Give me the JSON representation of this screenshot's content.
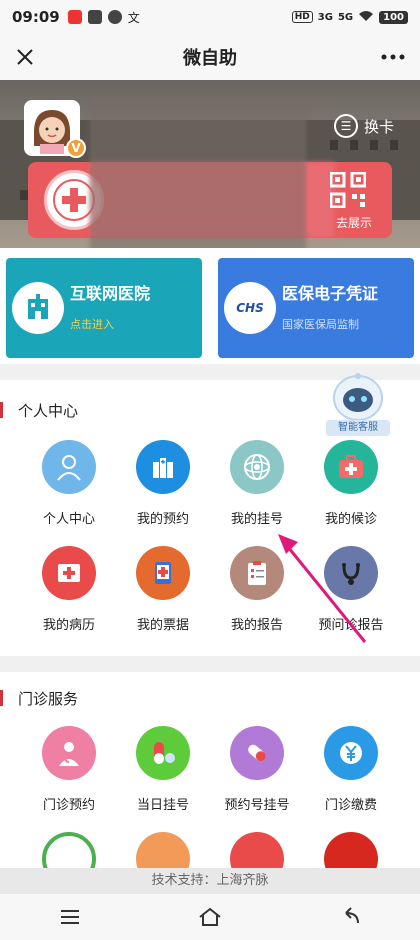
{
  "status": {
    "time": "09:09",
    "battery": "100",
    "network1": "HD",
    "network2": "3G",
    "network3": "5G"
  },
  "nav": {
    "title": "微自助"
  },
  "hero": {
    "switch_label": "换卡",
    "qr_label": "去展示",
    "badge": "V"
  },
  "services": [
    {
      "title": "互联网医院",
      "subtitle": "点击进入",
      "color": "#1aa5b8"
    },
    {
      "title": "医保电子凭证",
      "subtitle": "国家医保局监制",
      "logo": "CHS",
      "color": "#3a7be0"
    }
  ],
  "personal": {
    "title": "个人中心",
    "robot_label": "智能客服",
    "items": [
      {
        "label": "个人中心",
        "icon": "person-icon",
        "color": "#6fb6ea"
      },
      {
        "label": "我的预约",
        "icon": "hospital-building-icon",
        "color": "#1e8fe0"
      },
      {
        "label": "我的挂号",
        "icon": "registration-icon",
        "color": "#8cc7c7"
      },
      {
        "label": "我的候诊",
        "icon": "medical-kit-icon",
        "color": "#24b59b"
      },
      {
        "label": "我的病历",
        "icon": "medical-record-icon",
        "color": "#e94b4b"
      },
      {
        "label": "我的票据",
        "icon": "receipt-icon",
        "color": "#e46a2e"
      },
      {
        "label": "我的报告",
        "icon": "report-clipboard-icon",
        "color": "#b4887a"
      },
      {
        "label": "预问诊报告",
        "icon": "stethoscope-icon",
        "color": "#6878a8"
      }
    ]
  },
  "outpatient": {
    "title": "门诊服务",
    "items": [
      {
        "label": "门诊预约",
        "icon": "doctor-icon",
        "color": "#ef7fa3"
      },
      {
        "label": "当日挂号",
        "icon": "pill-icon",
        "color": "#5ecb3a"
      },
      {
        "label": "预约号挂号",
        "icon": "capsule-icon",
        "color": "#b07ad6"
      },
      {
        "label": "门诊缴费",
        "icon": "yuan-coin-icon",
        "color": "#2a9ae6"
      }
    ]
  },
  "footer": {
    "tech_support": "技术支持：上海齐脉"
  }
}
